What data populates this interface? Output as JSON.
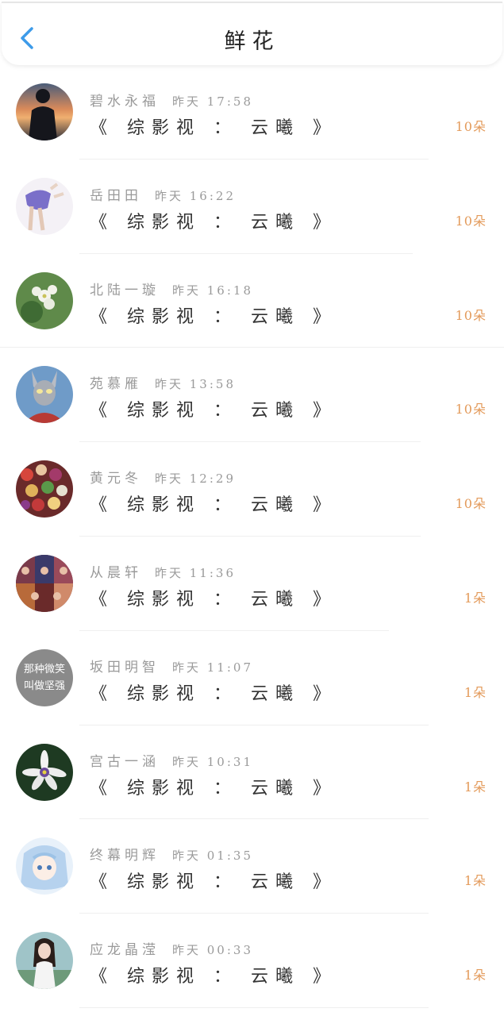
{
  "header": {
    "title": "鲜花"
  },
  "colors": {
    "accent": "#3d9be9",
    "count": "#e39a5a"
  },
  "items": [
    {
      "name": "碧水永福",
      "time": "昨天 17:58",
      "title": "《 综影视 ： 云曦 》",
      "count": "10朵"
    },
    {
      "name": "岳田田",
      "time": "昨天 16:22",
      "title": "《 综影视 ： 云曦 》",
      "count": "10朵"
    },
    {
      "name": "北陆一璇",
      "time": "昨天 16:18",
      "title": "《 综影视 ： 云曦 》",
      "count": "10朵"
    },
    {
      "name": "苑慕雁",
      "time": "昨天 13:58",
      "title": "《 综影视 ： 云曦 》",
      "count": "10朵"
    },
    {
      "name": "黄元冬",
      "time": "昨天 12:29",
      "title": "《 综影视 ： 云曦 》",
      "count": "10朵"
    },
    {
      "name": "从晨轩",
      "time": "昨天 11:36",
      "title": "《 综影视 ： 云曦 》",
      "count": "1朵"
    },
    {
      "name": "坂田明智",
      "time": "昨天 11:07",
      "title": "《 综影视 ： 云曦 》",
      "count": "1朵",
      "avatar_text": [
        "那种微笑",
        "叫做坚强"
      ]
    },
    {
      "name": "宫古一涵",
      "time": "昨天 10:31",
      "title": "《 综影视 ： 云曦 》",
      "count": "1朵"
    },
    {
      "name": "终幕明辉",
      "time": "昨天 01:35",
      "title": "《 综影视 ： 云曦 》",
      "count": "1朵"
    },
    {
      "name": "应龙晶滢",
      "time": "昨天 00:33",
      "title": "《 综影视 ： 云曦 》",
      "count": "1朵"
    }
  ]
}
